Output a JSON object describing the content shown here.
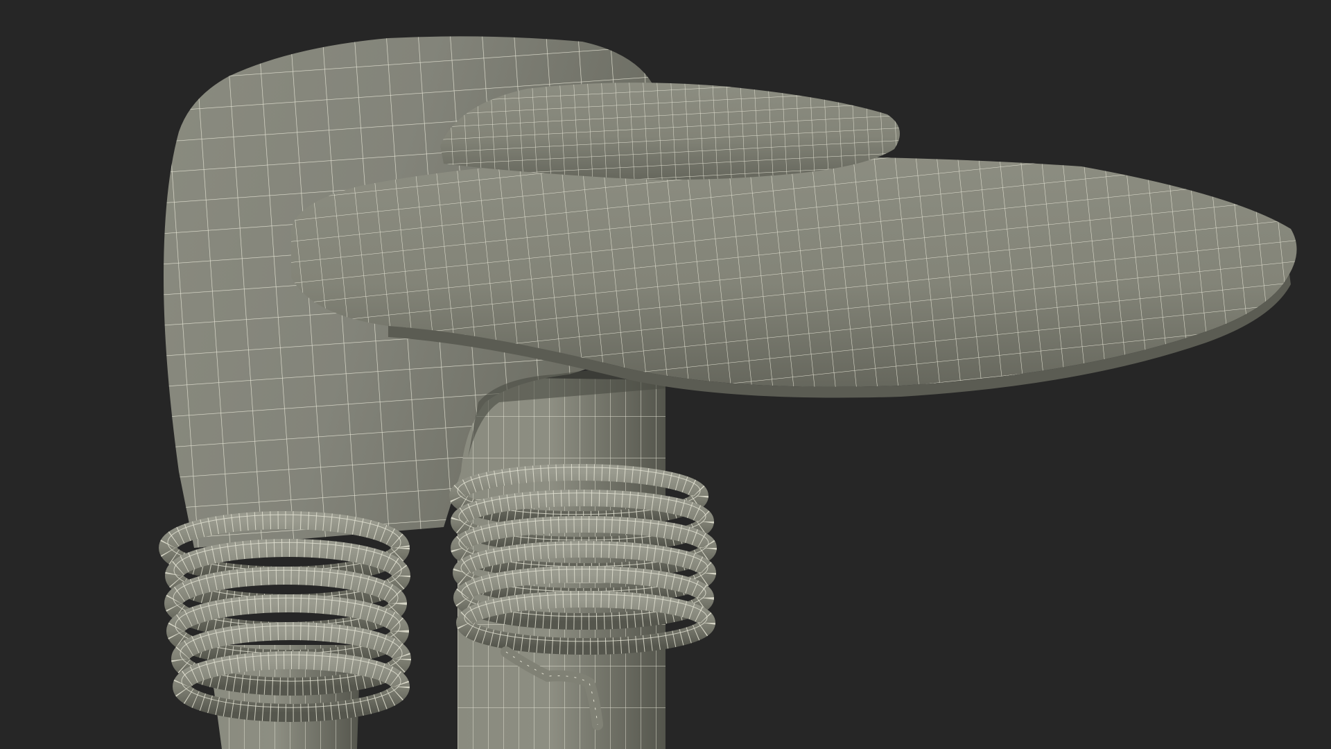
{
  "scene": {
    "subject": "wireframe-3d-model",
    "colors": {
      "background": "#262626",
      "surface": "#7e7f72",
      "surface_light": "#96978b",
      "surface_dark": "#5f6056",
      "wire": "#e4e3d4"
    }
  }
}
